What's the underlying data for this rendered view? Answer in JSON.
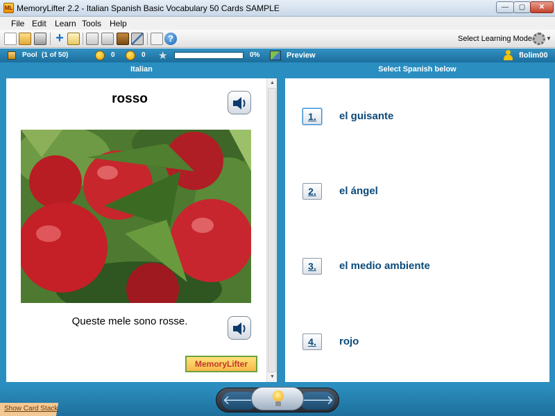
{
  "window": {
    "title": "MemoryLifter 2.2 - Italian Spanish Basic Vocabulary 50 Cards SAMPLE",
    "app_icon_text": "ML",
    "minimize": "—",
    "maximize": "▢",
    "close": "✕"
  },
  "menu": {
    "items": [
      "File",
      "Edit",
      "Learn",
      "Tools",
      "Help"
    ]
  },
  "toolbar": {
    "learning_mode_label": "Select Learning Mode(s)"
  },
  "status": {
    "pool_label": "Pool",
    "pool_count": "(1 of 50)",
    "known_count": "0",
    "unknown_count": "0",
    "progress_percent_text": "0%",
    "progress_value": 0,
    "preview_label": "Preview",
    "username": "flolim00"
  },
  "question": {
    "header": "Italian",
    "word": "rosso",
    "sentence": "Queste mele sono rosse.",
    "logo_text": "MemoryLifter"
  },
  "answers": {
    "header": "Select Spanish below",
    "options": [
      {
        "number": "1.",
        "text": "el guisante"
      },
      {
        "number": "2.",
        "text": "el ángel"
      },
      {
        "number": "3.",
        "text": "el medio ambiente"
      },
      {
        "number": "4.",
        "text": "rojo"
      }
    ]
  },
  "bottom": {
    "back_arrow": "🡐",
    "forward_arrow": "🡒",
    "show_card_stack": "Show Card Stack"
  },
  "colors": {
    "accent_blue": "#2a8ec0",
    "answer_text": "#0b4a7a",
    "progress_fill": "#5fbf40"
  }
}
